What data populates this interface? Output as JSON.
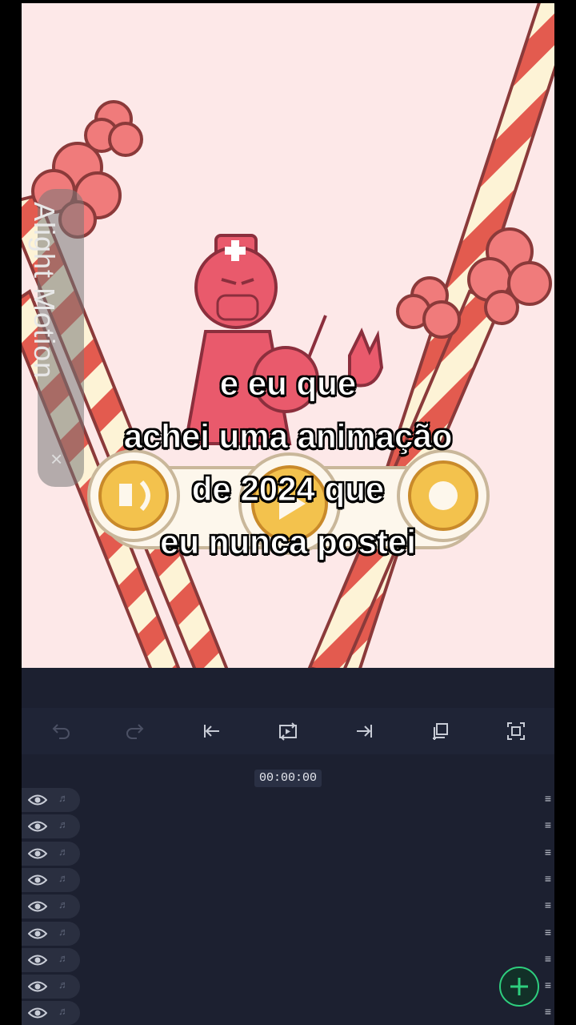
{
  "watermark": {
    "text": "Alight Motion",
    "close": "×"
  },
  "caption": {
    "line1": "e eu que",
    "line2": "achei uma animação",
    "line3": "de 2024 que",
    "line4": "eu nunca postei"
  },
  "toolbar": {
    "items": [
      "undo-icon",
      "redo-icon",
      "jump-start-icon",
      "loop-icon",
      "jump-end-icon",
      "copy-icon",
      "fullscreen-icon"
    ]
  },
  "timeline": {
    "timecode": "00:00:00",
    "layer_count": 9,
    "eye_icon": "eye-icon",
    "audio_icon": "♬",
    "handle_icon": "≡"
  },
  "fab": {
    "icon": "plus-icon"
  },
  "colors": {
    "canvas_bg": "#fde8e8",
    "stripe_red": "#e35b4f",
    "stripe_cream": "#fdf3d6",
    "character": "#e95a6c",
    "panel_bg": "#1c2030",
    "accent_green": "#2ecf7e"
  }
}
